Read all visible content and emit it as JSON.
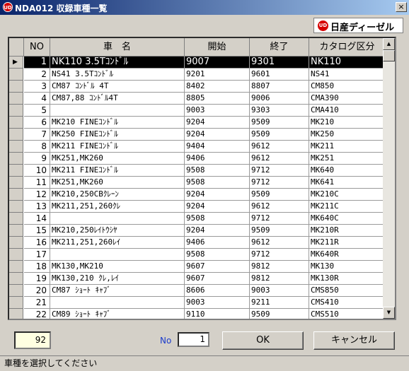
{
  "window": {
    "title": "NDA012 収録車種一覧",
    "logo_text": "UD",
    "close_label": "×"
  },
  "brand": {
    "logo_text": "UD",
    "text": "日産ディーゼル"
  },
  "grid": {
    "headers": {
      "no": "NO",
      "name": "車　名",
      "start": "開始",
      "end": "終了",
      "catalog": "カタログ区分"
    },
    "row_marker": "▶",
    "rows": [
      {
        "no": "1",
        "name": "NK110 3.5Tｺﾝﾄﾞﾙ",
        "start": "9007",
        "end": "9301",
        "catalog": "NK110"
      },
      {
        "no": "2",
        "name": "NS41  3.5Tｺﾝﾄﾞﾙ",
        "start": "9201",
        "end": "9601",
        "catalog": "NS41"
      },
      {
        "no": "3",
        "name": "CM87 ｺﾝﾄﾞﾙ 4T",
        "start": "8402",
        "end": "8807",
        "catalog": "CM850"
      },
      {
        "no": "4",
        "name": "CM87,88 ｺﾝﾄﾞﾙ4T",
        "start": "8805",
        "end": "9006",
        "catalog": "CMA390"
      },
      {
        "no": "5",
        "name": "",
        "start": "9003",
        "end": "9303",
        "catalog": "CMA410"
      },
      {
        "no": "6",
        "name": "MK210 FINEｺﾝﾄﾞﾙ",
        "start": "9204",
        "end": "9509",
        "catalog": "MK210"
      },
      {
        "no": "7",
        "name": "MK250 FINEｺﾝﾄﾞﾙ",
        "start": "9204",
        "end": "9509",
        "catalog": "MK250"
      },
      {
        "no": "8",
        "name": "MK211 FINEｺﾝﾄﾞﾙ",
        "start": "9404",
        "end": "9612",
        "catalog": "MK211"
      },
      {
        "no": "9",
        "name": "MK251,MK260",
        "start": "9406",
        "end": "9612",
        "catalog": "MK251"
      },
      {
        "no": "10",
        "name": "MK211 FINEｺﾝﾄﾞﾙ",
        "start": "9508",
        "end": "9712",
        "catalog": "MK640"
      },
      {
        "no": "11",
        "name": "MK251,MK260",
        "start": "9508",
        "end": "9712",
        "catalog": "MK641"
      },
      {
        "no": "12",
        "name": "MK210,250CBｸﾚｰﾝ",
        "start": "9204",
        "end": "9509",
        "catalog": "MK210C"
      },
      {
        "no": "13",
        "name": "MK211,251,260ｸﾚ",
        "start": "9204",
        "end": "9612",
        "catalog": "MK211C"
      },
      {
        "no": "14",
        "name": "",
        "start": "9508",
        "end": "9712",
        "catalog": "MK640C"
      },
      {
        "no": "15",
        "name": "MK210,250ﾚｲﾄｳｼﾔ",
        "start": "9204",
        "end": "9509",
        "catalog": "MK210R"
      },
      {
        "no": "16",
        "name": "MK211,251,260ﾚｲ",
        "start": "9406",
        "end": "9612",
        "catalog": "MK211R"
      },
      {
        "no": "17",
        "name": "",
        "start": "9508",
        "end": "9712",
        "catalog": "MK640R"
      },
      {
        "no": "18",
        "name": "MK130,MK210",
        "start": "9607",
        "end": "9812",
        "catalog": "MK130"
      },
      {
        "no": "19",
        "name": "MK130,210 ｸﾚ,ﾚｲ",
        "start": "9607",
        "end": "9812",
        "catalog": "MK130R"
      },
      {
        "no": "20",
        "name": "CM87  ｼｮｰﾄ ｷｬﾌﾞ",
        "start": "8606",
        "end": "9003",
        "catalog": "CMS850"
      },
      {
        "no": "21",
        "name": "",
        "start": "9003",
        "end": "9211",
        "catalog": "CMS410"
      },
      {
        "no": "22",
        "name": "CM89  ｼｮｰﾄ ｷｬﾌﾞ",
        "start": "9110",
        "end": "9509",
        "catalog": "CMS510"
      }
    ]
  },
  "footer": {
    "count": "92",
    "no_label": "No",
    "no_value": "1",
    "ok_label": "OK",
    "cancel_label": "キャンセル"
  },
  "status": {
    "text": "車種を選択してください"
  },
  "scrollbar": {
    "up_label": "▲",
    "down_label": "▼"
  }
}
